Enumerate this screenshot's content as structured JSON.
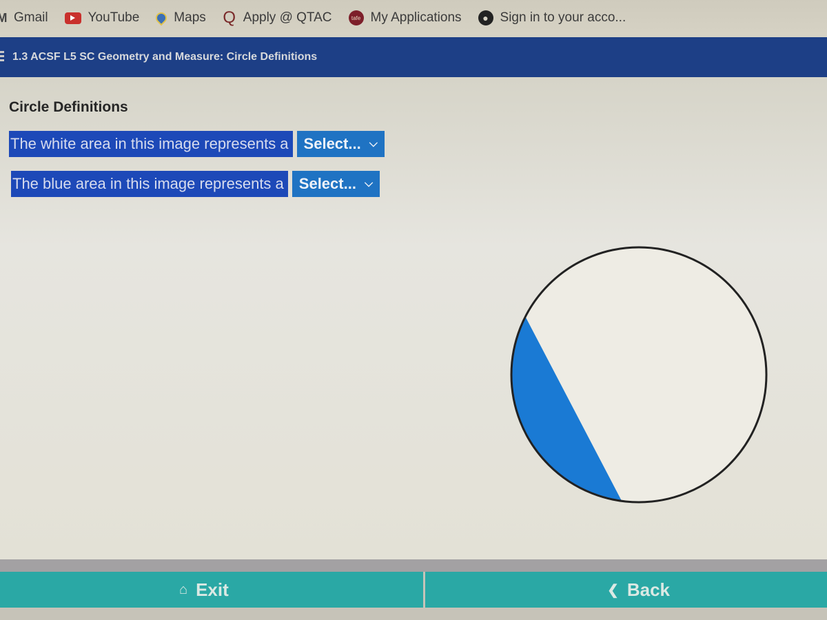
{
  "bookmarks": [
    {
      "label": "Gmail",
      "icon": "gmail-icon"
    },
    {
      "label": "YouTube",
      "icon": "youtube-icon"
    },
    {
      "label": "Maps",
      "icon": "maps-pin-icon"
    },
    {
      "label": "Apply @ QTAC",
      "icon": "qtac-q-icon"
    },
    {
      "label": "My Applications",
      "icon": "my-applications-icon"
    },
    {
      "label": "Sign in to your acco...",
      "icon": "globe-icon"
    }
  ],
  "header": {
    "title": "1.3 ACSF L5 SC Geometry and Measure: Circle Definitions"
  },
  "main": {
    "section_title": "Circle Definitions",
    "questions": [
      {
        "prompt": "The white area in this image represents a",
        "selected": "Select..."
      },
      {
        "prompt": "The blue area in this image represents a",
        "selected": "Select..."
      }
    ],
    "figure": {
      "description": "circle divided by a chord; smaller segment shaded blue",
      "colors": {
        "blue_segment": "#1a7ad4",
        "white_area": "#eeece4",
        "outline": "#222222"
      }
    }
  },
  "footer": {
    "exit_label": "Exit",
    "back_label": "Back"
  },
  "colors": {
    "header_bg": "#1d3f86",
    "question_bg": "#1d49b8",
    "select_bg": "#1f73c3",
    "footer_btn_bg": "#2aa8a5"
  }
}
